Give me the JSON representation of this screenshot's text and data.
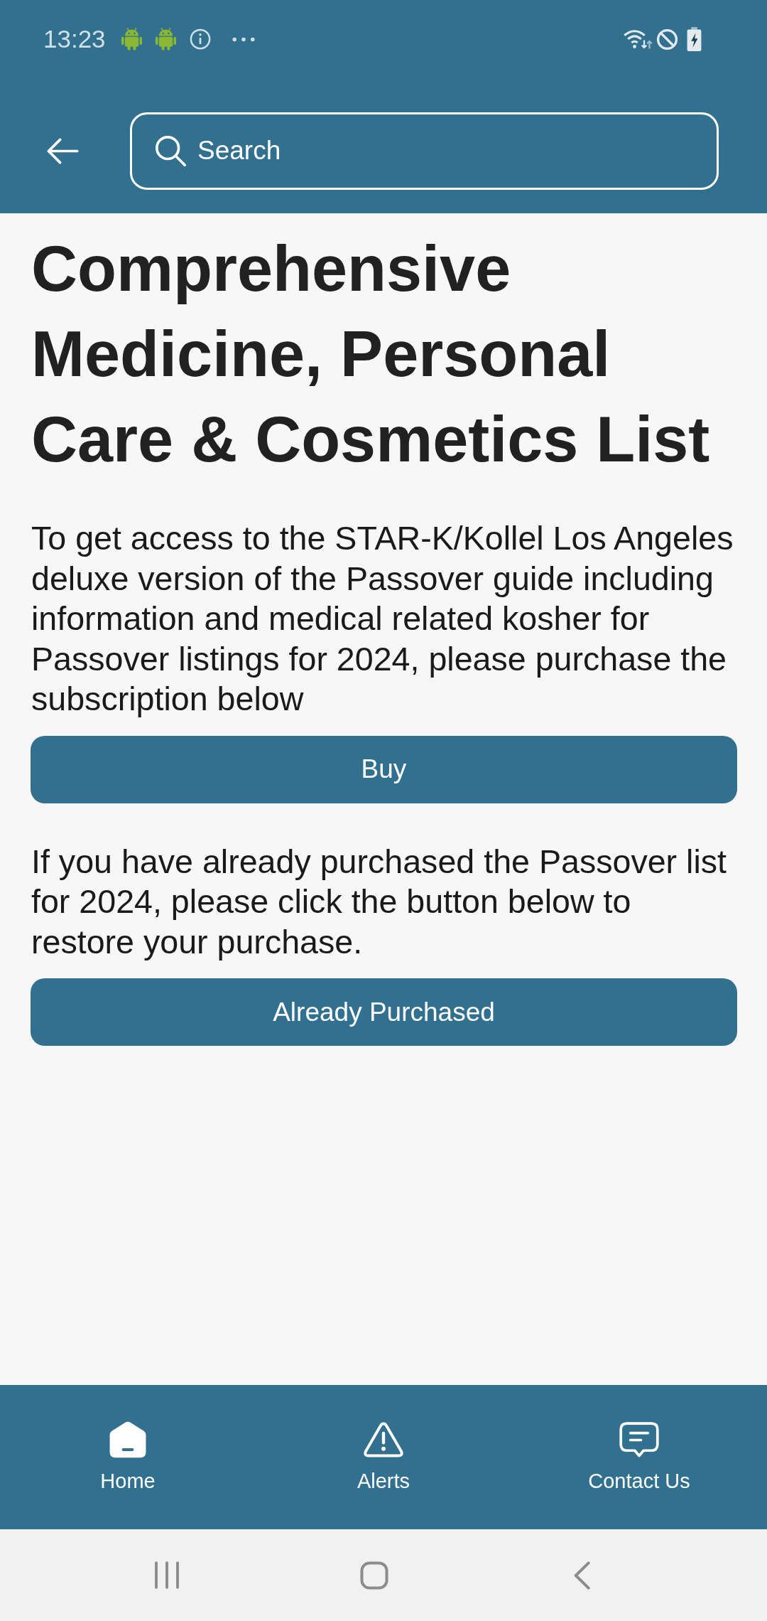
{
  "status_bar": {
    "time": "13:23"
  },
  "header": {
    "search": {
      "placeholder": "Search"
    }
  },
  "content": {
    "title": "Comprehensive Medicine, Personal Care & Cosmetics List",
    "sections": [
      {
        "text": "To get access to the STAR-K/Kollel Los Angeles deluxe version of the Passover guide including information and medical related kosher for Passover listings for 2024, please purchase the subscription below",
        "button": "Buy"
      },
      {
        "text": "If you have already purchased the Passover list for 2024, please click the button below to restore your purchase.",
        "button": "Already Purchased"
      }
    ]
  },
  "bottom_nav": [
    {
      "label": "Home",
      "kind": "home",
      "selected": true
    },
    {
      "label": "Alerts",
      "kind": "alert",
      "selected": false
    },
    {
      "label": "Contact Us",
      "kind": "chat",
      "selected": false
    }
  ]
}
